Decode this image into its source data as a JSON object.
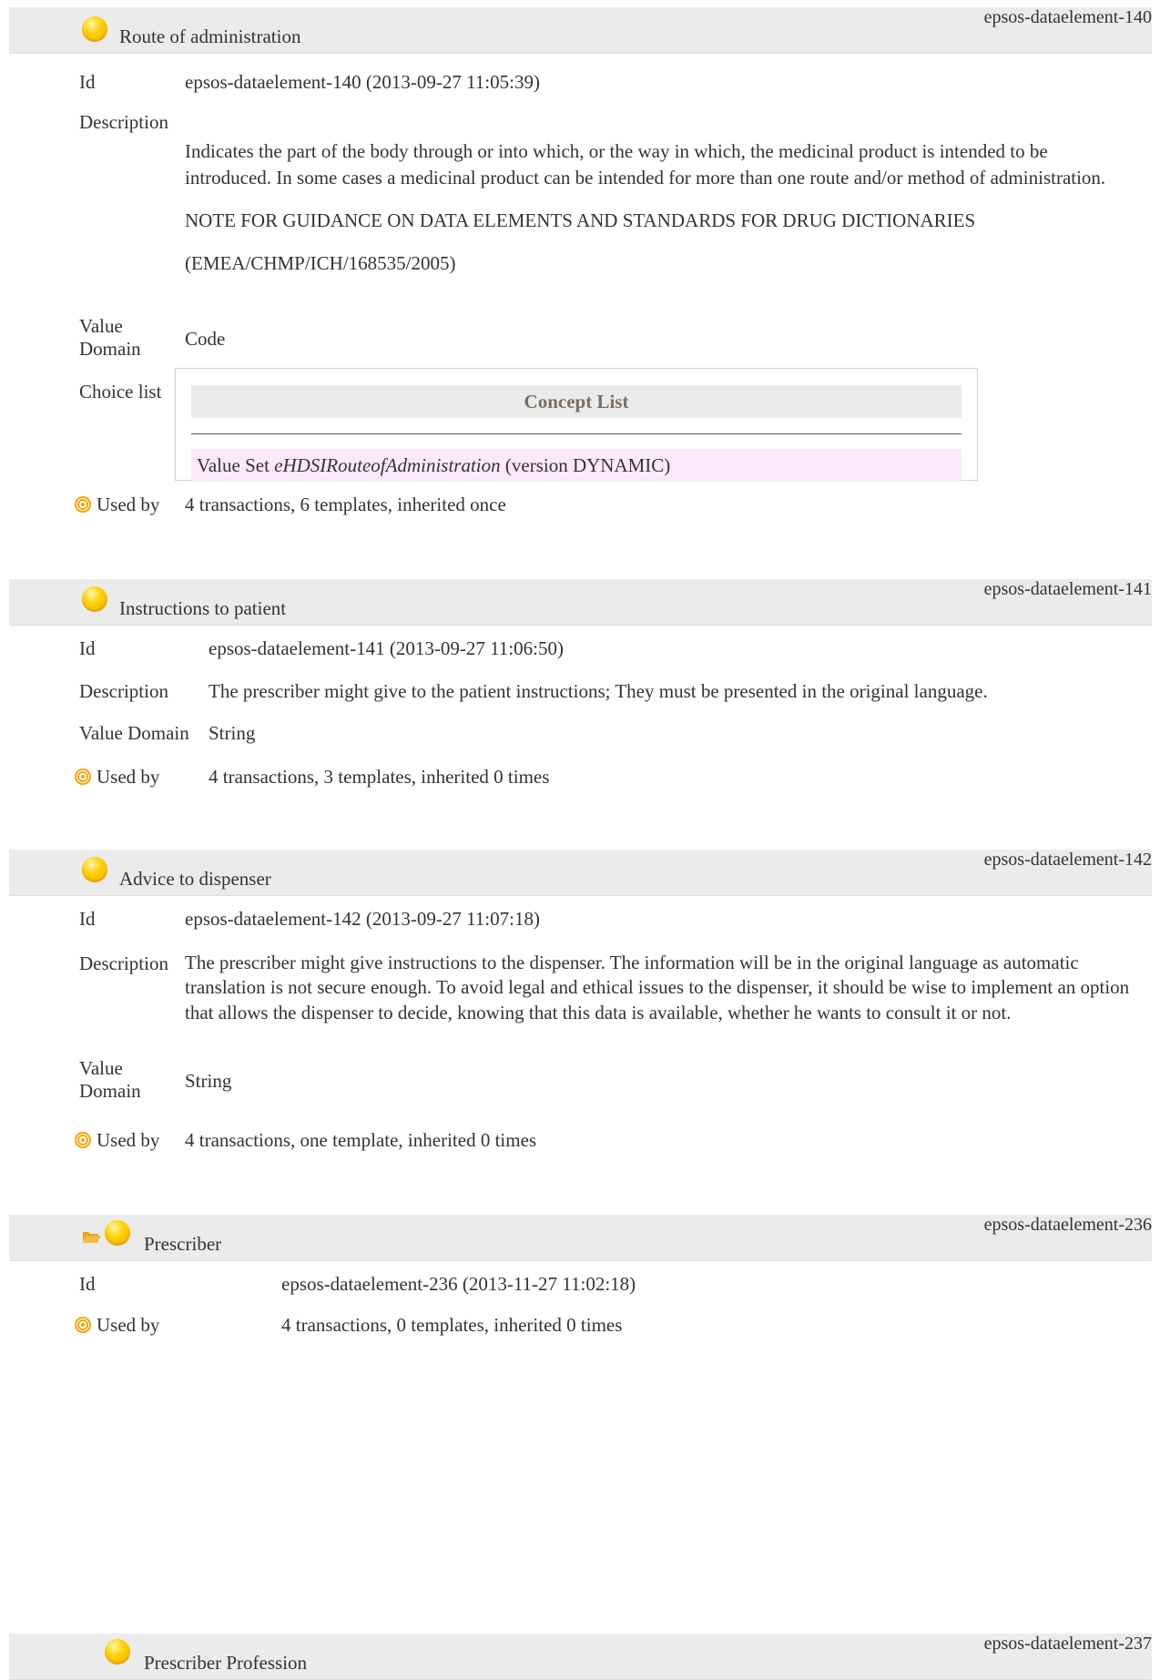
{
  "sections": [
    {
      "title": "Route of administration",
      "ref": "epsos-dataelement-140",
      "id_label": "Id",
      "id_value": "epsos-dataelement-140 (2013-09-27 11:05:39)",
      "desc_label": "Description",
      "desc_paragraphs": [
        "Indicates the part of the body through or into which, or the way in which, the medicinal product is intended to be introduced. In some cases a medicinal product can be intended for more than one route and/or method of administration.",
        "NOTE FOR GUIDANCE ON DATA ELEMENTS AND STANDARDS FOR DRUG DICTIONARIES",
        "(EMEA/CHMP/ICH/168535/2005)"
      ],
      "value_domain_label_1": "Value",
      "value_domain_label_2": "Domain",
      "value_domain": "Code",
      "choice_label": "Choice list",
      "concept_list_header": "Concept List",
      "value_set_prefix": "Value Set ",
      "value_set_name": "eHDSIRouteofAdministration",
      "value_set_suffix": " (version DYNAMIC)",
      "used_by_label": "Used by",
      "used_by_value": "4 transactions, 6 templates, inherited once"
    },
    {
      "title": "Instructions to patient",
      "ref": "epsos-dataelement-141",
      "id_label": "Id",
      "id_value": "epsos-dataelement-141 (2013-09-27 11:06:50)",
      "desc_label": "Description",
      "desc_value": "The prescriber might give to the patient instructions; They must be presented in the original language.",
      "value_domain_label": "Value Domain",
      "value_domain": "String",
      "used_by_label": "Used by",
      "used_by_value": "4 transactions, 3 templates, inherited 0 times"
    },
    {
      "title": "Advice to dispenser",
      "ref": "epsos-dataelement-142",
      "id_label": "Id",
      "id_value": "epsos-dataelement-142 (2013-09-27 11:07:18)",
      "desc_label": "Description",
      "desc_value": "The prescriber might give instructions to the dispenser. The information will be in the original language as automatic translation is not secure enough. To avoid legal and ethical issues to the dispenser, it should be wise to implement an option that allows the dispenser to decide, knowing that this data is available, whether he wants to consult it or not.",
      "value_domain_label_1": "Value",
      "value_domain_label_2": "Domain",
      "value_domain": "String",
      "used_by_label": "Used by",
      "used_by_value": "4 transactions, one template, inherited 0 times"
    },
    {
      "title": "Prescriber",
      "ref": "epsos-dataelement-236",
      "id_label": "Id",
      "id_value": "epsos-dataelement-236 (2013-11-27 11:02:18)",
      "used_by_label": "Used by",
      "used_by_value": "4 transactions, 0 templates, inherited 0 times"
    },
    {
      "title": "Prescriber Profession",
      "ref": "epsos-dataelement-237"
    }
  ],
  "colors": {
    "header_bg": "#ebebeb",
    "value_set_row_bg": "#fce9fc",
    "concept_header_text": "#7a6d60",
    "status_dot": "#ffd000",
    "used_by_icon": "#f7a400"
  },
  "icons": [
    "status-dot-icon",
    "folder-open-icon",
    "used-by-target-icon"
  ]
}
